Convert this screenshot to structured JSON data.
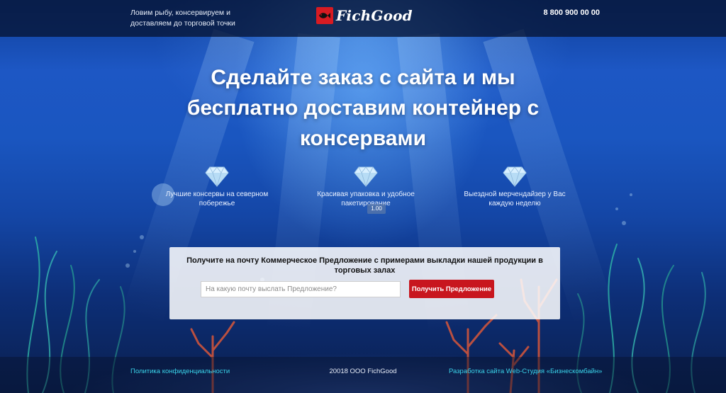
{
  "header": {
    "tagline": "Ловим рыбу, консервируем и доставляем до торговой точки",
    "logo_text": "FichGood",
    "logo_icon": "fish-icon",
    "phone": "8 800 900 00 00"
  },
  "hero": {
    "title": "Сделайте заказ с сайта и мы бесплатно доставим контейнер с консервами"
  },
  "features": [
    {
      "icon": "diamond-icon",
      "text": "Лучшие консервы на северном побережье"
    },
    {
      "icon": "diamond-icon",
      "text": "Красивая упаковка и удобное пакетирование"
    },
    {
      "icon": "diamond-icon",
      "text": "Выездной мерчендайзер у Вас каждую неделю"
    }
  ],
  "tooltip": "1.00",
  "form": {
    "title": "Получите на почту Коммерческое Предложение с примерами выкладки нашей продукции в торговых залах",
    "email_placeholder": "На какую почту выслать Предложение?",
    "email_value": "",
    "submit_label": "Получить Предложение"
  },
  "footer": {
    "privacy_link": "Политика конфиденциальности",
    "copyright": "20018 ООО FichGood",
    "developer_link": "Разработка сайта Web-Студия «Бизнескомбайн»"
  },
  "colors": {
    "accent": "#c8161e",
    "link": "#3ad2e8",
    "header_bg": "#061434"
  }
}
